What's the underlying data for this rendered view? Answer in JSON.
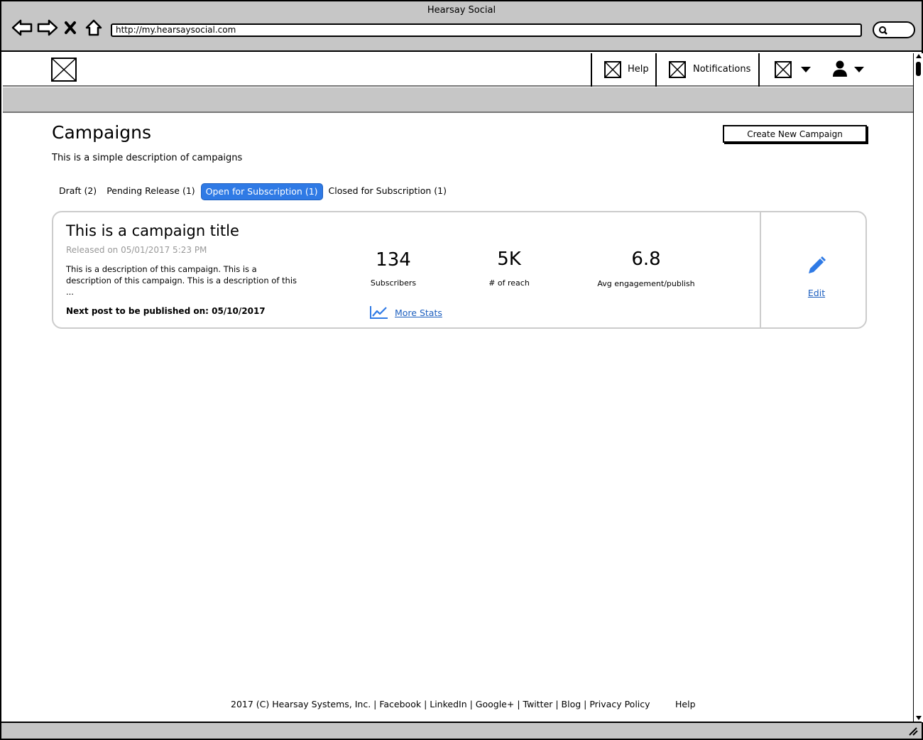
{
  "browser": {
    "window_title": "Hearsay Social",
    "url": "http://my.hearsaysocial.com"
  },
  "header": {
    "nav": {
      "help_label": "Help",
      "notifications_label": "Notifications"
    }
  },
  "page": {
    "title": "Campaigns",
    "description": "This is a simple description of campaigns",
    "create_button_label": "Create New Campaign"
  },
  "tabs": [
    {
      "label": "Draft (2)",
      "active": false
    },
    {
      "label": "Pending Release (1)",
      "active": false
    },
    {
      "label": "Open for Subscription (1)",
      "active": true
    },
    {
      "label": "Closed for Subscription (1)",
      "active": false
    }
  ],
  "campaign": {
    "title": "This is a campaign title",
    "released": "Released on 05/01/2017 5:23 PM",
    "description": "This is a description of this campaign. This is a description of this campaign. This is a description of this ...",
    "next_post": "Next post to be published on: 05/10/2017",
    "stats": [
      {
        "value": "134",
        "label": "Subscribers"
      },
      {
        "value": "5K",
        "label": "# of reach"
      },
      {
        "value": "6.8",
        "label": "Avg engagement/publish"
      }
    ],
    "more_stats_label": "More Stats",
    "edit_label": "Edit"
  },
  "footer": {
    "links": "2017 (C) Hearsay Systems, Inc. | Facebook | LinkedIn | Google+ | Twitter | Blog | Privacy Policy",
    "help_label": "Help"
  },
  "colors": {
    "accent": "#2f7ae5",
    "link": "#1d5fbf",
    "chrome_gray": "#c6c6c6"
  },
  "icons": [
    "back-arrow-icon",
    "forward-arrow-icon",
    "close-x-icon",
    "home-icon",
    "search-icon",
    "placeholder-image-icon",
    "caret-down-icon",
    "user-icon",
    "trend-chart-icon",
    "pencil-icon",
    "resize-grip-icon"
  ]
}
